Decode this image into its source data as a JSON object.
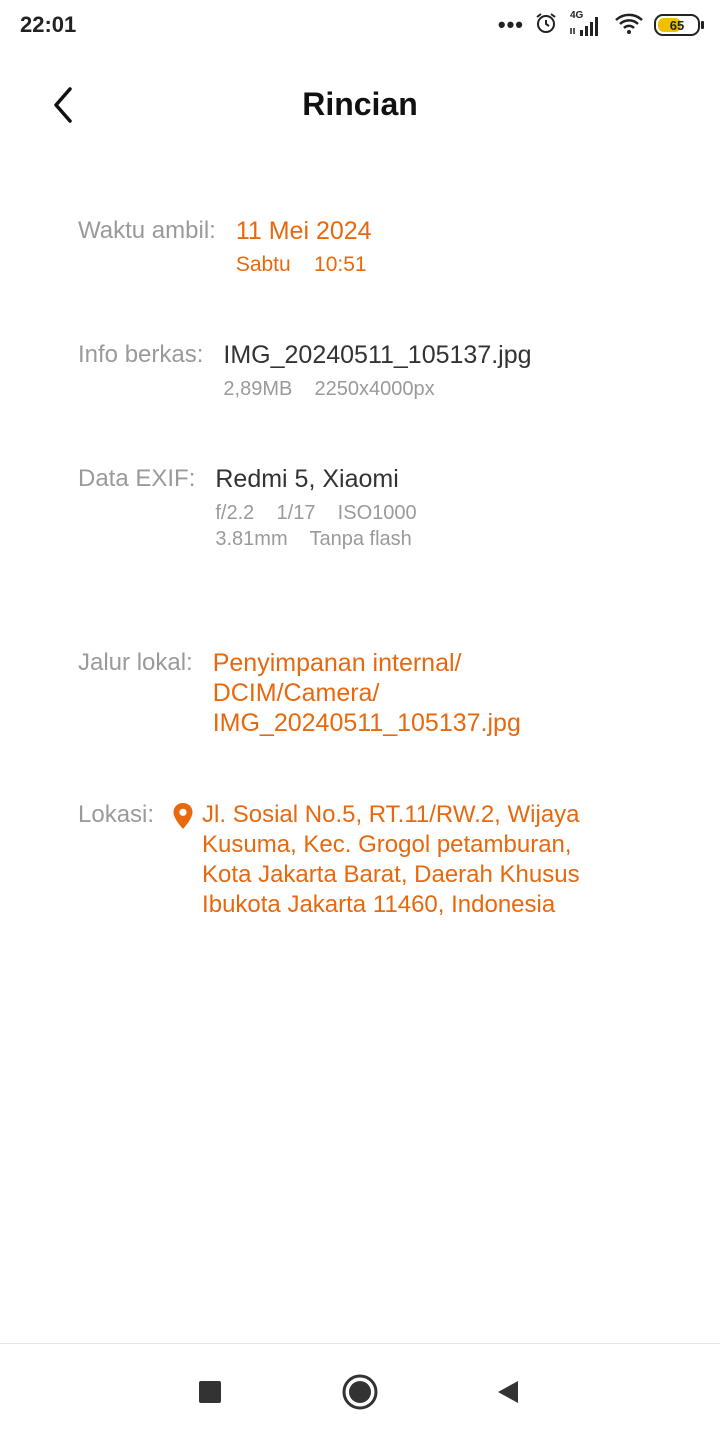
{
  "status_bar": {
    "time": "22:01",
    "more": "•••",
    "network": "4G",
    "battery": "65",
    "battery_level": 0.65
  },
  "header": {
    "title": "Rincian"
  },
  "details": {
    "taken": {
      "label": "Waktu ambil:",
      "date": "11 Mei 2024",
      "day_time": "Sabtu    10:51"
    },
    "file": {
      "label": "Info berkas:",
      "name": "IMG_20240511_105137.jpg",
      "meta": "2,89MB    2250x4000px"
    },
    "exif": {
      "label": "Data EXIF:",
      "device": "Redmi 5, Xiaomi",
      "line1": "f/2.2    1/17    ISO1000",
      "line2": "3.81mm    Tanpa flash"
    },
    "path": {
      "label": "Jalur lokal:",
      "line1": "Penyimpanan internal/",
      "line2": "DCIM/Camera/",
      "line3": "IMG_20240511_105137.jpg"
    },
    "location": {
      "label": "Lokasi:",
      "address": "Jl. Sosial No.5, RT.11/RW.2, Wijaya Kusuma, Kec. Grogol petamburan, Kota Jakarta Barat, Daerah Khusus Ibukota Jakarta 11460, Indonesia"
    }
  },
  "colors": {
    "accent": "#e8680e",
    "label": "#9a9a9a",
    "text": "#333333"
  },
  "icons": {
    "back": "chevron-left-icon",
    "location": "map-pin-icon",
    "nav_recents": "square-icon",
    "nav_home": "circle-icon",
    "nav_back": "triangle-left-icon"
  }
}
